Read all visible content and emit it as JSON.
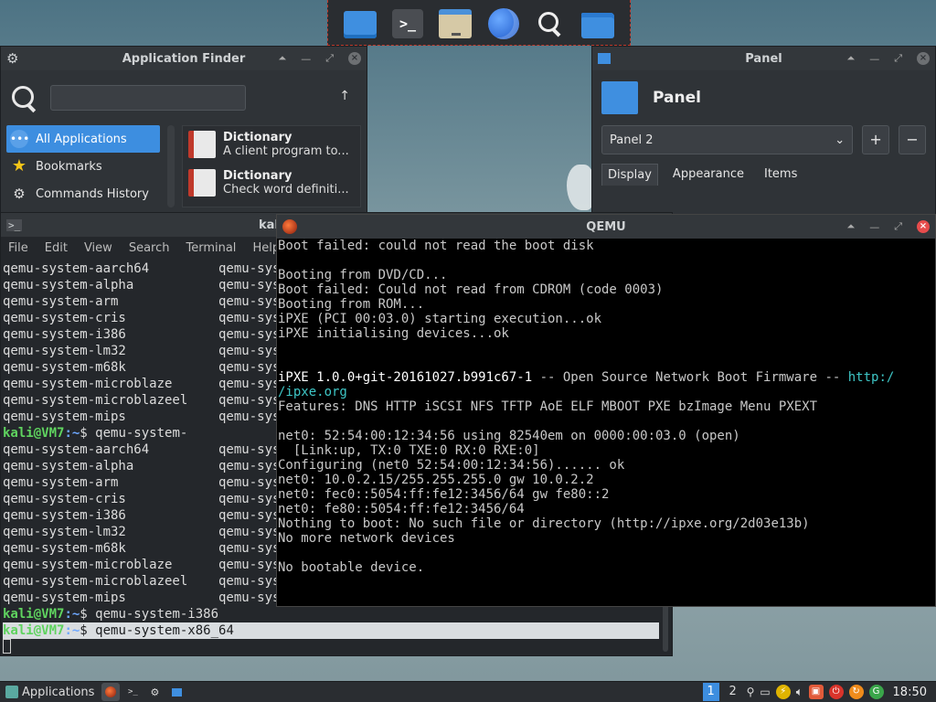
{
  "app_finder": {
    "title": "Application Finder",
    "search_value": "",
    "categories": [
      {
        "label": "All Applications",
        "icon": "all-apps-icon",
        "selected": true
      },
      {
        "label": "Bookmarks",
        "icon": "star-icon",
        "selected": false
      },
      {
        "label": "Commands History",
        "icon": "gear-icon",
        "selected": false
      }
    ],
    "apps": [
      {
        "name": "Dictionary",
        "desc": "A client program to..."
      },
      {
        "name": "Dictionary",
        "desc": "Check word definiti..."
      }
    ]
  },
  "panel_window": {
    "title": "Panel",
    "heading": "Panel",
    "selected_panel": "Panel 2",
    "add_label": "+",
    "remove_label": "−",
    "tabs": [
      "Display",
      "Appearance",
      "Items"
    ]
  },
  "terminal": {
    "title": "kali",
    "menu": [
      "File",
      "Edit",
      "View",
      "Search",
      "Terminal",
      "Help"
    ],
    "list_a": [
      "qemu-system-aarch64",
      "qemu-system-alpha",
      "qemu-system-arm",
      "qemu-system-cris",
      "qemu-system-i386",
      "qemu-system-lm32",
      "qemu-system-m68k",
      "qemu-system-microblaze",
      "qemu-system-microblazeel",
      "qemu-system-mips"
    ],
    "col2_prefix": "qemu-sys",
    "prompt_user": "kali@VM7",
    "prompt_path": ":~",
    "prompt_symbol": "$",
    "cmd1": " qemu-system-",
    "cmd2": " qemu-system-i386",
    "cmd3": " qemu-system-x86_64"
  },
  "qemu": {
    "title": "QEMU",
    "lines": [
      "Boot failed: could not read the boot disk",
      "",
      "Booting from DVD/CD...",
      "Boot failed: Could not read from CDROM (code 0003)",
      "Booting from ROM...",
      "iPXE (PCI 00:03.0) starting execution...ok",
      "iPXE initialising devices...ok",
      "",
      "",
      "",
      "",
      "Features: DNS HTTP iSCSI NFS TFTP AoE ELF MBOOT PXE bzImage Menu PXEXT",
      "",
      "net0: 52:54:00:12:34:56 using 82540em on 0000:00:03.0 (open)",
      "  [Link:up, TX:0 TXE:0 RX:0 RXE:0]",
      "Configuring (net0 52:54:00:12:34:56)...... ok",
      "net0: 10.0.2.15/255.255.255.0 gw 10.0.2.2",
      "net0: fec0::5054:ff:fe12:3456/64 gw fe80::2",
      "net0: fe80::5054:ff:fe12:3456/64",
      "Nothing to boot: No such file or directory (http://ipxe.org/2d03e13b)",
      "No more network devices",
      "",
      "No bootable device."
    ],
    "ipxe_version": "iPXE 1.0.0+git-20161027.b991c67-1",
    "ipxe_desc": " -- Open Source Network Boot Firmware -- ",
    "ipxe_url1": "http:/",
    "ipxe_url2": "/ipxe.org"
  },
  "taskbar": {
    "apps_label": "Applications",
    "workspaces": [
      "1",
      "2"
    ],
    "clock": "18:50"
  },
  "colors": {
    "accent": "#3d8ee0",
    "close_red": "#e74c4c",
    "prompt_green": "#5fd35f",
    "prompt_blue": "#6ea8ff"
  }
}
